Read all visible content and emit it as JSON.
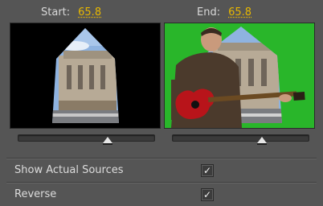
{
  "start": {
    "label": "Start:",
    "value": "65.8",
    "slider_fraction": 0.658
  },
  "end": {
    "label": "End:",
    "value": "65.8",
    "slider_fraction": 0.658
  },
  "options": [
    {
      "label": "Show Actual Sources",
      "checked": true
    },
    {
      "label": "Reverse",
      "checked": true
    }
  ],
  "colors": {
    "accent": "#e8b800",
    "green_screen": "#29b62a",
    "panel": "#555555"
  }
}
